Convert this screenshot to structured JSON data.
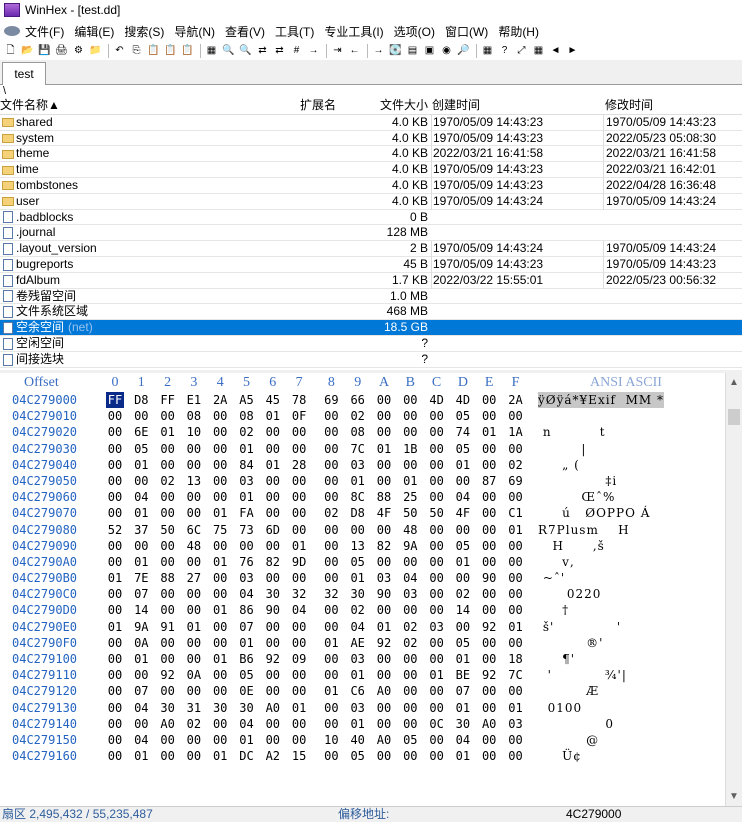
{
  "window": {
    "title": "WinHex - [test.dd]"
  },
  "menu": [
    "文件(F)",
    "编辑(E)",
    "搜索(S)",
    "导航(N)",
    "查看(V)",
    "工具(T)",
    "专业工具(I)",
    "选项(O)",
    "窗口(W)",
    "帮助(H)"
  ],
  "toolbar_icons": [
    "new-icon",
    "open-icon",
    "save-icon",
    "print-icon",
    "properties-icon",
    "open-folder-icon",
    "undo-icon",
    "copy-icon",
    "paste-icon",
    "clipboard-icon",
    "paste-special-icon",
    "fill-icon",
    "find-icon",
    "find-hex-icon",
    "replace-icon",
    "replace-hex-icon",
    "search-integer-icon",
    "goto-offset-icon",
    "goto-sector-icon",
    "back-icon",
    "forward-icon",
    "disk-icon",
    "ram-icon",
    "image-icon",
    "view-icon",
    "zoom-icon",
    "calc-icon",
    "help-icon",
    "fullscreen-icon",
    "hexview-icon",
    "prev-icon",
    "next-icon"
  ],
  "tab": {
    "label": "test"
  },
  "path": "\\",
  "filelist": {
    "headers": {
      "name": "文件名称▲",
      "ext": "扩展名",
      "size": "文件大小",
      "created": "创建时间",
      "modified": "修改时间"
    },
    "rows": [
      {
        "icon": "folder",
        "name": "shared",
        "ext": "",
        "size": "4.0 KB",
        "created": "1970/05/09  14:43:23",
        "modified": "1970/05/09  14:43:23"
      },
      {
        "icon": "folder",
        "name": "system",
        "ext": "",
        "size": "4.0 KB",
        "created": "1970/05/09  14:43:23",
        "modified": "2022/05/23  05:08:30"
      },
      {
        "icon": "folder",
        "name": "theme",
        "ext": "",
        "size": "4.0 KB",
        "created": "2022/03/21  16:41:58",
        "modified": "2022/03/21  16:41:58"
      },
      {
        "icon": "folder",
        "name": "time",
        "ext": "",
        "size": "4.0 KB",
        "created": "1970/05/09  14:43:23",
        "modified": "2022/03/21  16:42:01"
      },
      {
        "icon": "folder",
        "name": "tombstones",
        "ext": "",
        "size": "4.0 KB",
        "created": "1970/05/09  14:43:23",
        "modified": "2022/04/28  16:36:48"
      },
      {
        "icon": "folder",
        "name": "user",
        "ext": "",
        "size": "4.0 KB",
        "created": "1970/05/09  14:43:24",
        "modified": "1970/05/09  14:43:24"
      },
      {
        "icon": "file",
        "name": ".badblocks",
        "ext": "",
        "size": "0 B",
        "created": "",
        "modified": ""
      },
      {
        "icon": "file",
        "name": ".journal",
        "ext": "",
        "size": "128 MB",
        "created": "",
        "modified": ""
      },
      {
        "icon": "file",
        "name": ".layout_version",
        "ext": "",
        "size": "2 B",
        "created": "1970/05/09  14:43:24",
        "modified": "1970/05/09  14:43:24"
      },
      {
        "icon": "file",
        "name": "bugreports",
        "ext": "",
        "size": "45 B",
        "created": "1970/05/09  14:43:23",
        "modified": "1970/05/09  14:43:23"
      },
      {
        "icon": "file",
        "name": "fdAlbum",
        "ext": "",
        "size": "1.7 KB",
        "created": "2022/03/22  15:55:01",
        "modified": "2022/05/23  00:56:32"
      },
      {
        "icon": "file",
        "name": "卷残留空间",
        "ext": "",
        "size": "1.0 MB",
        "created": "",
        "modified": ""
      },
      {
        "icon": "file",
        "name": "文件系统区域",
        "ext": "",
        "size": "468 MB",
        "created": "",
        "modified": ""
      },
      {
        "icon": "file",
        "name": "空余空间",
        "suffix": "(net)",
        "ext": "",
        "size": "18.5 GB",
        "created": "",
        "modified": "",
        "selected": true
      },
      {
        "icon": "file",
        "name": "空闲空间",
        "ext": "",
        "size": "?",
        "created": "",
        "modified": ""
      },
      {
        "icon": "file",
        "name": "间接选块",
        "ext": "",
        "size": "?",
        "created": "",
        "modified": ""
      }
    ]
  },
  "hex": {
    "header": {
      "offset": "Offset",
      "cols": [
        "0",
        "1",
        "2",
        "3",
        "4",
        "5",
        "6",
        "7",
        "8",
        "9",
        "A",
        "B",
        "C",
        "D",
        "E",
        "F"
      ],
      "ascii": "ANSI ASCII"
    },
    "rows": [
      {
        "off": "04C279000",
        "bytes": [
          "FF",
          "D8",
          "FF",
          "E1",
          "2A",
          "A5",
          "45",
          "78",
          "69",
          "66",
          "00",
          "00",
          "4D",
          "4D",
          "00",
          "2A"
        ],
        "ascii": "ÿØÿá*¥Exif  MM *"
      },
      {
        "off": "04C279010",
        "bytes": [
          "00",
          "00",
          "00",
          "08",
          "00",
          "08",
          "01",
          "0F",
          "00",
          "02",
          "00",
          "00",
          "00",
          "05",
          "00",
          "00"
        ],
        "ascii": ""
      },
      {
        "off": "04C279020",
        "bytes": [
          "00",
          "6E",
          "01",
          "10",
          "00",
          "02",
          "00",
          "00",
          "00",
          "08",
          "00",
          "00",
          "00",
          "74",
          "01",
          "1A"
        ],
        "ascii": " n          t"
      },
      {
        "off": "04C279030",
        "bytes": [
          "00",
          "05",
          "00",
          "00",
          "00",
          "01",
          "00",
          "00",
          "00",
          "7C",
          "01",
          "1B",
          "00",
          "05",
          "00",
          "00"
        ],
        "ascii": "         |"
      },
      {
        "off": "04C279040",
        "bytes": [
          "00",
          "01",
          "00",
          "00",
          "00",
          "84",
          "01",
          "28",
          "00",
          "03",
          "00",
          "00",
          "00",
          "01",
          "00",
          "02"
        ],
        "ascii": "     „ ("
      },
      {
        "off": "04C279050",
        "bytes": [
          "00",
          "00",
          "02",
          "13",
          "00",
          "03",
          "00",
          "00",
          "00",
          "01",
          "00",
          "01",
          "00",
          "00",
          "87",
          "69"
        ],
        "ascii": "              ‡i"
      },
      {
        "off": "04C279060",
        "bytes": [
          "00",
          "04",
          "00",
          "00",
          "00",
          "01",
          "00",
          "00",
          "00",
          "8C",
          "88",
          "25",
          "00",
          "04",
          "00",
          "00"
        ],
        "ascii": "         Œˆ%"
      },
      {
        "off": "04C279070",
        "bytes": [
          "00",
          "01",
          "00",
          "00",
          "01",
          "FA",
          "00",
          "00",
          "02",
          "D8",
          "4F",
          "50",
          "50",
          "4F",
          "00",
          "C1"
        ],
        "ascii": "     ú   ØOPPO Á"
      },
      {
        "off": "04C279080",
        "bytes": [
          "52",
          "37",
          "50",
          "6C",
          "75",
          "73",
          "6D",
          "00",
          "00",
          "00",
          "00",
          "48",
          "00",
          "00",
          "00",
          "01"
        ],
        "ascii": "R7Plusm    H"
      },
      {
        "off": "04C279090",
        "bytes": [
          "00",
          "00",
          "00",
          "48",
          "00",
          "00",
          "00",
          "01",
          "00",
          "13",
          "82",
          "9A",
          "00",
          "05",
          "00",
          "00"
        ],
        "ascii": "   H      ‚š"
      },
      {
        "off": "04C2790A0",
        "bytes": [
          "00",
          "01",
          "00",
          "00",
          "01",
          "76",
          "82",
          "9D",
          "00",
          "05",
          "00",
          "00",
          "00",
          "01",
          "00",
          "00"
        ],
        "ascii": "     v‚"
      },
      {
        "off": "04C2790B0",
        "bytes": [
          "01",
          "7E",
          "88",
          "27",
          "00",
          "03",
          "00",
          "00",
          "00",
          "01",
          "03",
          "04",
          "00",
          "00",
          "90",
          "00"
        ],
        "ascii": " ~ˆ'"
      },
      {
        "off": "04C2790C0",
        "bytes": [
          "00",
          "07",
          "00",
          "00",
          "00",
          "04",
          "30",
          "32",
          "32",
          "30",
          "90",
          "03",
          "00",
          "02",
          "00",
          "00"
        ],
        "ascii": "      0220"
      },
      {
        "off": "04C2790D0",
        "bytes": [
          "00",
          "14",
          "00",
          "00",
          "01",
          "86",
          "90",
          "04",
          "00",
          "02",
          "00",
          "00",
          "00",
          "14",
          "00",
          "00"
        ],
        "ascii": "     †"
      },
      {
        "off": "04C2790E0",
        "bytes": [
          "01",
          "9A",
          "91",
          "01",
          "00",
          "07",
          "00",
          "00",
          "00",
          "04",
          "01",
          "02",
          "03",
          "00",
          "92",
          "01"
        ],
        "ascii": " š'             '"
      },
      {
        "off": "04C2790F0",
        "bytes": [
          "00",
          "0A",
          "00",
          "00",
          "00",
          "01",
          "00",
          "00",
          "01",
          "AE",
          "92",
          "02",
          "00",
          "05",
          "00",
          "00"
        ],
        "ascii": "          ®'"
      },
      {
        "off": "04C279100",
        "bytes": [
          "00",
          "01",
          "00",
          "00",
          "01",
          "B6",
          "92",
          "09",
          "00",
          "03",
          "00",
          "00",
          "00",
          "01",
          "00",
          "18"
        ],
        "ascii": "     ¶'"
      },
      {
        "off": "04C279110",
        "bytes": [
          "00",
          "00",
          "92",
          "0A",
          "00",
          "05",
          "00",
          "00",
          "00",
          "01",
          "00",
          "00",
          "01",
          "BE",
          "92",
          "7C"
        ],
        "ascii": "  '           ¾'|"
      },
      {
        "off": "04C279120",
        "bytes": [
          "00",
          "07",
          "00",
          "00",
          "00",
          "0E",
          "00",
          "00",
          "01",
          "C6",
          "A0",
          "00",
          "00",
          "07",
          "00",
          "00"
        ],
        "ascii": "          Æ"
      },
      {
        "off": "04C279130",
        "bytes": [
          "00",
          "04",
          "30",
          "31",
          "30",
          "30",
          "A0",
          "01",
          "00",
          "03",
          "00",
          "00",
          "00",
          "01",
          "00",
          "01"
        ],
        "ascii": "  0100"
      },
      {
        "off": "04C279140",
        "bytes": [
          "00",
          "00",
          "A0",
          "02",
          "00",
          "04",
          "00",
          "00",
          "00",
          "01",
          "00",
          "00",
          "0C",
          "30",
          "A0",
          "03"
        ],
        "ascii": "              0"
      },
      {
        "off": "04C279150",
        "bytes": [
          "00",
          "04",
          "00",
          "00",
          "00",
          "01",
          "00",
          "00",
          "10",
          "40",
          "A0",
          "05",
          "00",
          "04",
          "00",
          "00"
        ],
        "ascii": "          @"
      },
      {
        "off": "04C279160",
        "bytes": [
          "00",
          "01",
          "00",
          "00",
          "01",
          "DC",
          "A2",
          "15",
          "00",
          "05",
          "00",
          "00",
          "00",
          "01",
          "00",
          "00"
        ],
        "ascii": "     Ü¢"
      }
    ]
  },
  "status": {
    "sector": "扇区 2,495,432 / 55,235,487",
    "offset_label": "偏移地址:",
    "offset_value": "4C279000"
  }
}
